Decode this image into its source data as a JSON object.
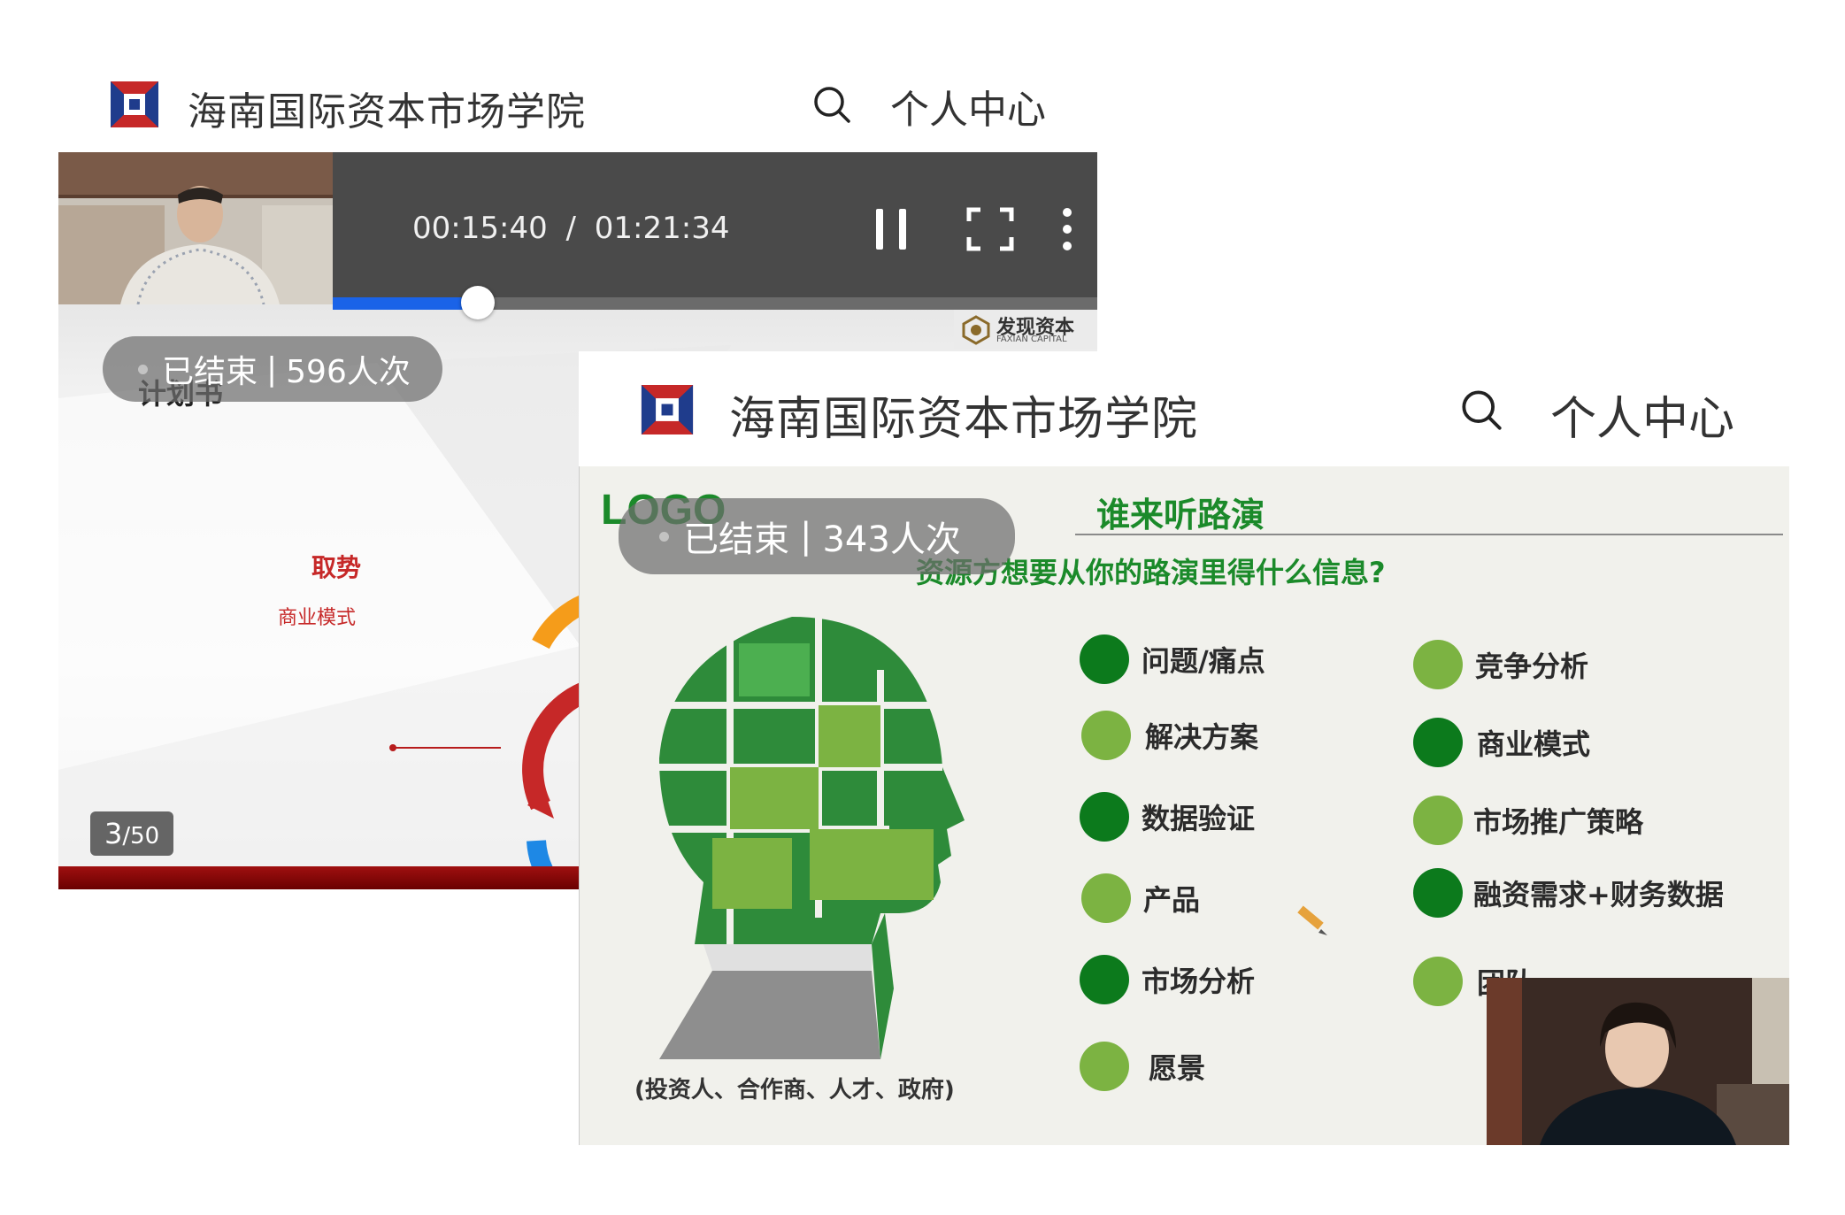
{
  "card1": {
    "header": {
      "title": "海南国际资本市场学院",
      "profile_label": "个人中心"
    },
    "player": {
      "current_time": "00:15:40",
      "separator": "/",
      "total_time": "01:21:34",
      "progress": 0.19
    },
    "status": {
      "state": "已结束",
      "separator": "|",
      "views": "596人次"
    },
    "watermark": {
      "cn": "发现资本",
      "en": "FAXIAN CAPITAL"
    },
    "slide": {
      "heading": "计划书",
      "label": "取势",
      "sublabel": "商业模式"
    },
    "page": {
      "current": "3",
      "total": "/50"
    }
  },
  "card2": {
    "header": {
      "title": "海南国际资本市场学院",
      "profile_label": "个人中心"
    },
    "status": {
      "state": "已结束",
      "separator": "|",
      "views": "343人次"
    },
    "slide": {
      "logo": "LOGO",
      "title": "谁来听路演",
      "subtitle": "资源方想要从你的路演里得什么信息?",
      "caption": "(投资人、合作商、人才、政府)",
      "topics_left": [
        "问题/痛点",
        "解决方案",
        "数据验证",
        "产品",
        "市场分析",
        "愿景"
      ],
      "topics_right": [
        "竞争分析",
        "商业模式",
        "市场推广策略",
        "融资需求+财务数据",
        "团队"
      ]
    }
  },
  "colors": {
    "accent_blue": "#1a63e8",
    "dark_green": "#0c7a1c",
    "light_green": "#7cb342",
    "red": "#c62828"
  }
}
